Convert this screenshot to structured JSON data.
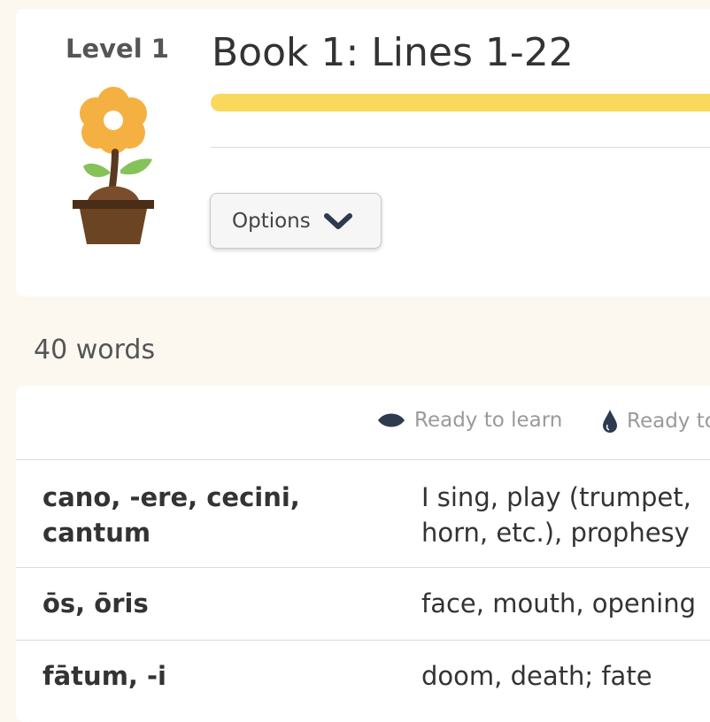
{
  "header": {
    "level": "Level 1",
    "title": "Book 1: Lines 1-22",
    "progress_fraction": 1.0,
    "options_label": "Options",
    "level_icon": "flower-pot-icon"
  },
  "list": {
    "word_count": "40 words",
    "legend": [
      {
        "icon": "eye-icon",
        "label": "Ready to learn"
      },
      {
        "icon": "water-drop-icon",
        "label": "Ready to"
      }
    ],
    "words": [
      {
        "term": "cano, -ere, cecini, cantum",
        "definition": "I sing, play (trumpet, horn, etc.), prophesy"
      },
      {
        "term": "ōs, ōris",
        "definition": "face, mouth, opening"
      },
      {
        "term": "fātum, -i",
        "definition": "doom, death; fate"
      }
    ]
  },
  "colors": {
    "background": "#fcf8f0",
    "progress": "#f9d95c",
    "petal": "#f4b142",
    "leaf": "#86c25a",
    "pot": "#6b4424",
    "icon_dark": "#2e3a4e"
  }
}
